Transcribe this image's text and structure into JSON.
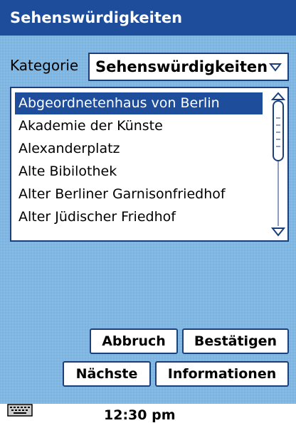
{
  "window": {
    "title": "Sehenswürdigkeiten"
  },
  "category": {
    "label": "Kategorie",
    "selected": "Sehenswürdigkeiten"
  },
  "list": {
    "items": [
      "Abgeordnetenhaus von Berlin",
      "Akademie der Künste",
      "Alexanderplatz",
      "Alte Bibilothek",
      "Alter Berliner Garnisonfriedhof",
      "Alter Jüdischer Friedhof"
    ],
    "selected_index": 0
  },
  "buttons": {
    "cancel": "Abbruch",
    "confirm": "Bestätigen",
    "next": "Nächste",
    "info": "Informationen"
  },
  "status": {
    "time": "12:30 pm"
  },
  "colors": {
    "titlebar": "#1d4d9b",
    "background": "#80b7e2",
    "selection": "#1d4d9b",
    "border": "#1b3f7a"
  }
}
